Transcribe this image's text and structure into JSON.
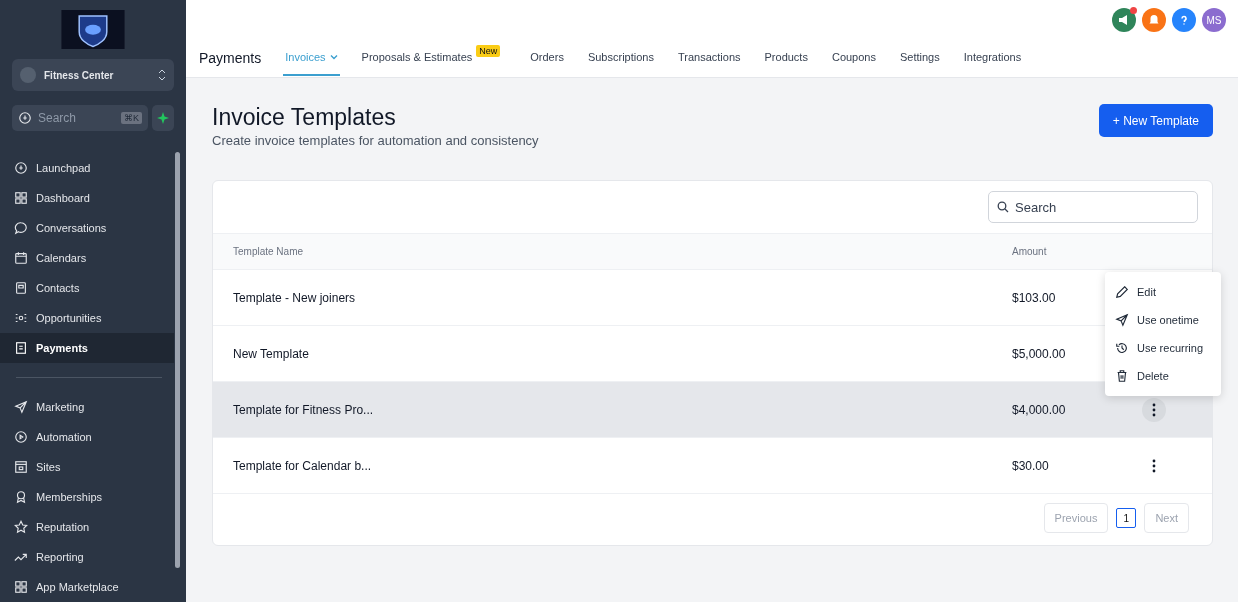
{
  "sidebar": {
    "location": {
      "name": "Fitness Center"
    },
    "search": {
      "placeholder": "Search",
      "shortcut": "⌘K"
    },
    "items": [
      {
        "label": "Launchpad",
        "selected": false
      },
      {
        "label": "Dashboard",
        "selected": false
      },
      {
        "label": "Conversations",
        "selected": false
      },
      {
        "label": "Calendars",
        "selected": false
      },
      {
        "label": "Contacts",
        "selected": false
      },
      {
        "label": "Opportunities",
        "selected": false
      },
      {
        "label": "Payments",
        "selected": true
      }
    ],
    "items_2": [
      {
        "label": "Marketing",
        "selected": false
      },
      {
        "label": "Automation",
        "selected": false
      },
      {
        "label": "Sites",
        "selected": false
      },
      {
        "label": "Memberships",
        "selected": false
      },
      {
        "label": "Reputation",
        "selected": false
      },
      {
        "label": "Reporting",
        "selected": false
      },
      {
        "label": "App Marketplace",
        "selected": false
      }
    ]
  },
  "header": {
    "avatar": "MS",
    "title": "Payments",
    "tabs": [
      {
        "label": "Invoices",
        "selected": true,
        "dropdown": true
      },
      {
        "label": "Proposals & Estimates",
        "selected": false,
        "dropdown": false,
        "badge": "New"
      },
      {
        "label": "Orders",
        "selected": false,
        "dropdown": false
      },
      {
        "label": "Subscriptions",
        "selected": false,
        "dropdown": false
      },
      {
        "label": "Transactions",
        "selected": false,
        "dropdown": false
      },
      {
        "label": "Products",
        "selected": false,
        "dropdown": false
      },
      {
        "label": "Coupons",
        "selected": false,
        "dropdown": false
      },
      {
        "label": "Settings",
        "selected": false,
        "dropdown": false
      },
      {
        "label": "Integrations",
        "selected": false,
        "dropdown": false
      }
    ]
  },
  "page": {
    "title": "Invoice Templates",
    "subtitle": "Create invoice templates for automation and consistency",
    "new_button": "+ New Template"
  },
  "table": {
    "search": {
      "placeholder": "Search"
    },
    "columns": [
      "Template Name",
      "Amount"
    ],
    "rows": [
      {
        "name": "Template - New joiners",
        "amount": "$103.00",
        "selected": false
      },
      {
        "name": "New Template",
        "amount": "$5,000.00",
        "selected": false
      },
      {
        "name": "Template for Fitness Pro...",
        "amount": "$4,000.00",
        "selected": true,
        "menu_button": true
      },
      {
        "name": "Template for Calendar b...",
        "amount": "$30.00",
        "selected": false,
        "menu_button": true
      }
    ],
    "pagination": {
      "previous": "Previous",
      "page": "1",
      "next": "Next"
    }
  },
  "menu": [
    {
      "label": "Edit"
    },
    {
      "label": "Use onetime"
    },
    {
      "label": "Use recurring"
    },
    {
      "label": "Delete"
    }
  ]
}
